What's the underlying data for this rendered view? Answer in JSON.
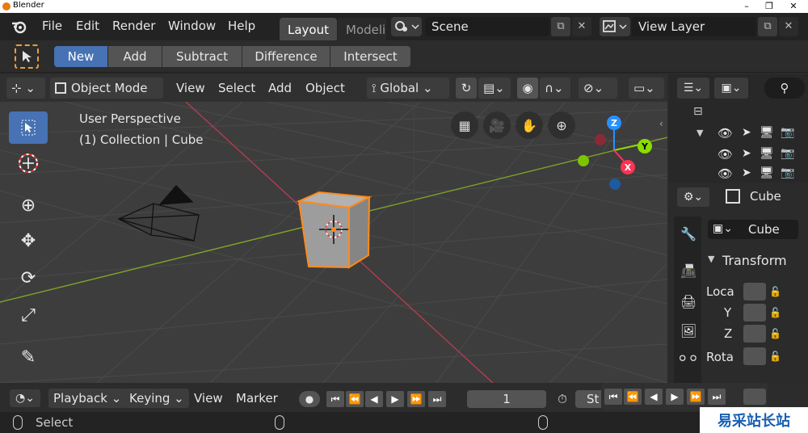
{
  "app": {
    "title": "Blender"
  },
  "window_controls": {
    "minimize": "–",
    "maximize": "❐",
    "close": "✕"
  },
  "menu": {
    "file": "File",
    "edit": "Edit",
    "render": "Render",
    "window": "Window",
    "help": "Help"
  },
  "workspaces": {
    "active": "Layout",
    "next": "Modeli"
  },
  "scene": {
    "name": "Scene"
  },
  "view_layer": {
    "name": "View Layer"
  },
  "boolean_mode": {
    "new": "New",
    "add": "Add",
    "subtract": "Subtract",
    "difference": "Difference",
    "intersect": "Intersect"
  },
  "viewport_header": {
    "mode": "Object Mode",
    "view": "View",
    "select": "Select",
    "add": "Add",
    "object": "Object",
    "orientation": "Global"
  },
  "overlay_text": {
    "perspective": "User Perspective",
    "collection": "(1) Collection | Cube"
  },
  "gizmo_axes": {
    "z": "Z",
    "y": "Y",
    "x": "X"
  },
  "properties": {
    "object_name": "Cube",
    "data_name": "Cube",
    "section": "Transform",
    "loc": "Loca",
    "y": "Y",
    "z": "Z",
    "rot": "Rota"
  },
  "timeline": {
    "playback": "Playback",
    "keying": "Keying",
    "view": "View",
    "marker": "Marker",
    "frame": "1",
    "start_label": "St"
  },
  "status": {
    "select": "Select"
  },
  "watermark": {
    "text": "易采站长站"
  },
  "colors": {
    "accent": "#4772b3",
    "selected_outline": "#ff8a1a",
    "x_axis": "#ff3352",
    "y_axis": "#8bdc00",
    "z_axis": "#2890ff"
  }
}
